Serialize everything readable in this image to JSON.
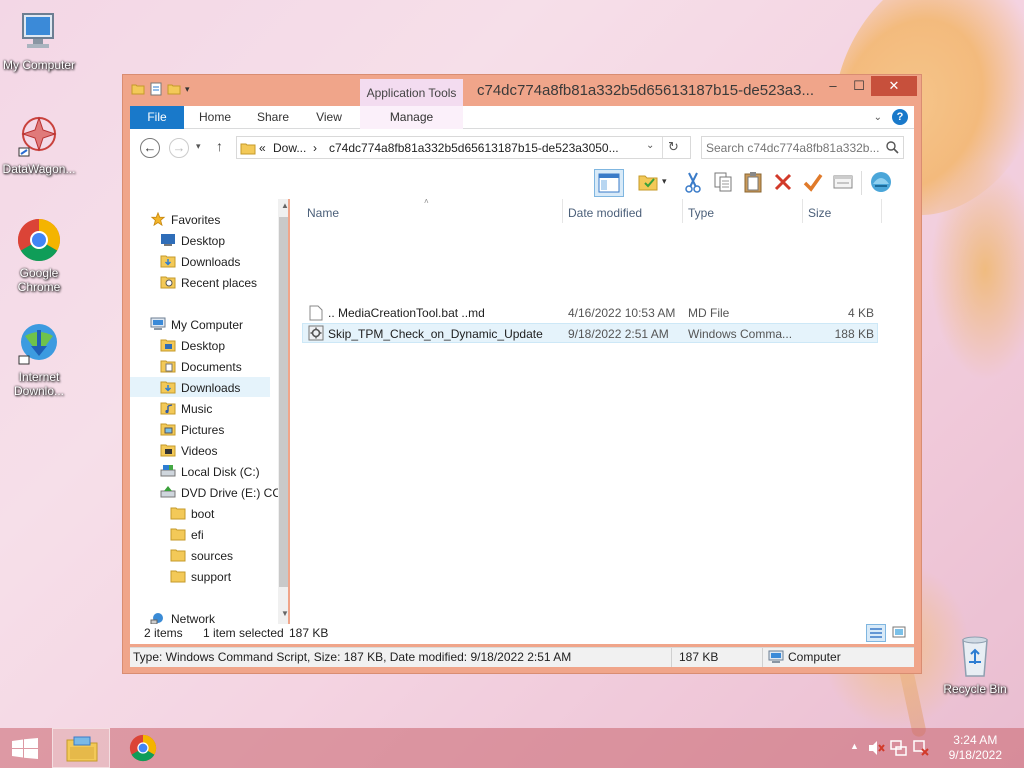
{
  "desktop": {
    "icons": [
      {
        "label": "My Computer"
      },
      {
        "label": "DataWagon..."
      },
      {
        "label": "Google Chrome"
      },
      {
        "label": "Internet Downlo..."
      },
      {
        "label": "Recycle Bin"
      }
    ]
  },
  "window": {
    "contextual_tab_group": "Application Tools",
    "title": "c74dc774a8fb81a332b5d65613187b15-de523a3...",
    "controls": {
      "minimize": "–",
      "maximize": "☐",
      "close": "✕"
    },
    "tabs": {
      "file": "File",
      "home": "Home",
      "share": "Share",
      "view": "View",
      "manage": "Manage"
    },
    "help_glyph": "?"
  },
  "address": {
    "prefix": "«",
    "crumb1": "Dow...",
    "sep": "›",
    "crumb2": "c74dc774a8fb81a332b5d65613187b15-de523a3050...",
    "search_placeholder": "Search c74dc774a8fb81a332b..."
  },
  "nav": {
    "favorites": "Favorites",
    "fav_items": [
      "Desktop",
      "Downloads",
      "Recent places"
    ],
    "computer": "My Computer",
    "computer_items": [
      "Desktop",
      "Documents",
      "Downloads",
      "Music",
      "Pictures",
      "Videos",
      "Local Disk (C:)",
      "DVD Drive (E:) CC"
    ],
    "dvd_items": [
      "boot",
      "efi",
      "sources",
      "support"
    ],
    "network": "Network"
  },
  "columns": {
    "name": "Name",
    "date": "Date modified",
    "type": "Type",
    "size": "Size"
  },
  "files": [
    {
      "name": ".. MediaCreationTool.bat ..md",
      "date": "4/16/2022 10:53 AM",
      "type": "MD File",
      "size": "4 KB"
    },
    {
      "name": "Skip_TPM_Check_on_Dynamic_Update",
      "date": "9/18/2022 2:51 AM",
      "type": "Windows Comma...",
      "size": "188 KB"
    }
  ],
  "status": {
    "count": "2 items",
    "selected": "1 item selected",
    "selected_size": "187 KB",
    "details": "Type: Windows Command Script, Size: 187 KB, Date modified: 9/18/2022 2:51 AM",
    "size": "187 KB",
    "location": "Computer"
  },
  "taskbar": {
    "time": "3:24 AM",
    "date": "9/18/2022"
  },
  "colors": {
    "accent": "#1979ca",
    "title_frame": "#f0a58a",
    "close_button": "#c7503c"
  }
}
